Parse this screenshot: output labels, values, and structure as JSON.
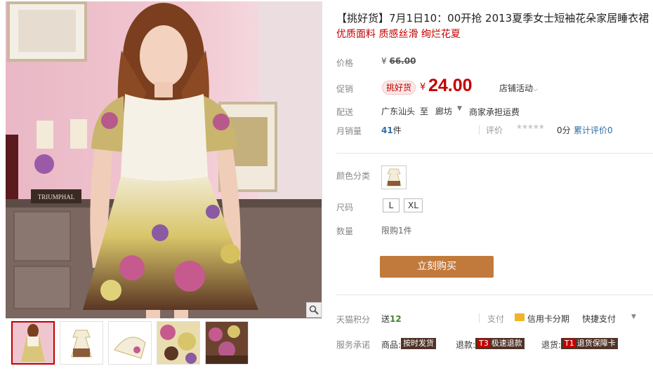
{
  "product": {
    "title": "【挑好货】7月1日10：00开抢 2013夏季女士短袖花朵家居睡衣裙",
    "subtitle": "优质面料 质感丝滑 绚烂花夏"
  },
  "gallery": {
    "main_image_sign": "TRIUMPHAL",
    "thumbnail_count": 5
  },
  "price": {
    "label": "价格",
    "currency": "¥",
    "original": "66.00"
  },
  "promo": {
    "label": "促销",
    "badge": "挑好货",
    "currency": "¥",
    "price": "24.00",
    "shop_activity": "店铺活动"
  },
  "shipping": {
    "label": "配送",
    "from": "广东汕头",
    "to_word": "至",
    "destination": "廊坊",
    "fee": "商家承担运费"
  },
  "sales": {
    "label": "月销量",
    "count": "41",
    "unit": "件",
    "rating_label": "评价",
    "stars": "★★★★★",
    "score": "0分",
    "total_reviews": "累计评价0"
  },
  "options": {
    "color_label": "颜色分类",
    "size_label": "尺码",
    "sizes": [
      "L",
      "XL"
    ],
    "quantity_label": "数量",
    "quantity_limit": "限购1件"
  },
  "buy_button": "立刻购买",
  "points": {
    "label": "天猫积分",
    "prefix": "送",
    "value": "12"
  },
  "payment": {
    "label": "支付",
    "credit": "信用卡分期",
    "quick": "快捷支付"
  },
  "service": {
    "label": "服务承诺",
    "goods_label": "商品:",
    "goods_tag": "按时发货",
    "refund_label": "退款:",
    "refund_code": "T3",
    "refund_tag": "极速退款",
    "return_label": "退货:",
    "return_code": "T1",
    "return_tag": "退货保障卡"
  },
  "colors": {
    "accent_red": "#c40000",
    "buy_button": "#c27a3c",
    "link_blue": "#2e6ea6",
    "points_green": "#3c8a28"
  }
}
